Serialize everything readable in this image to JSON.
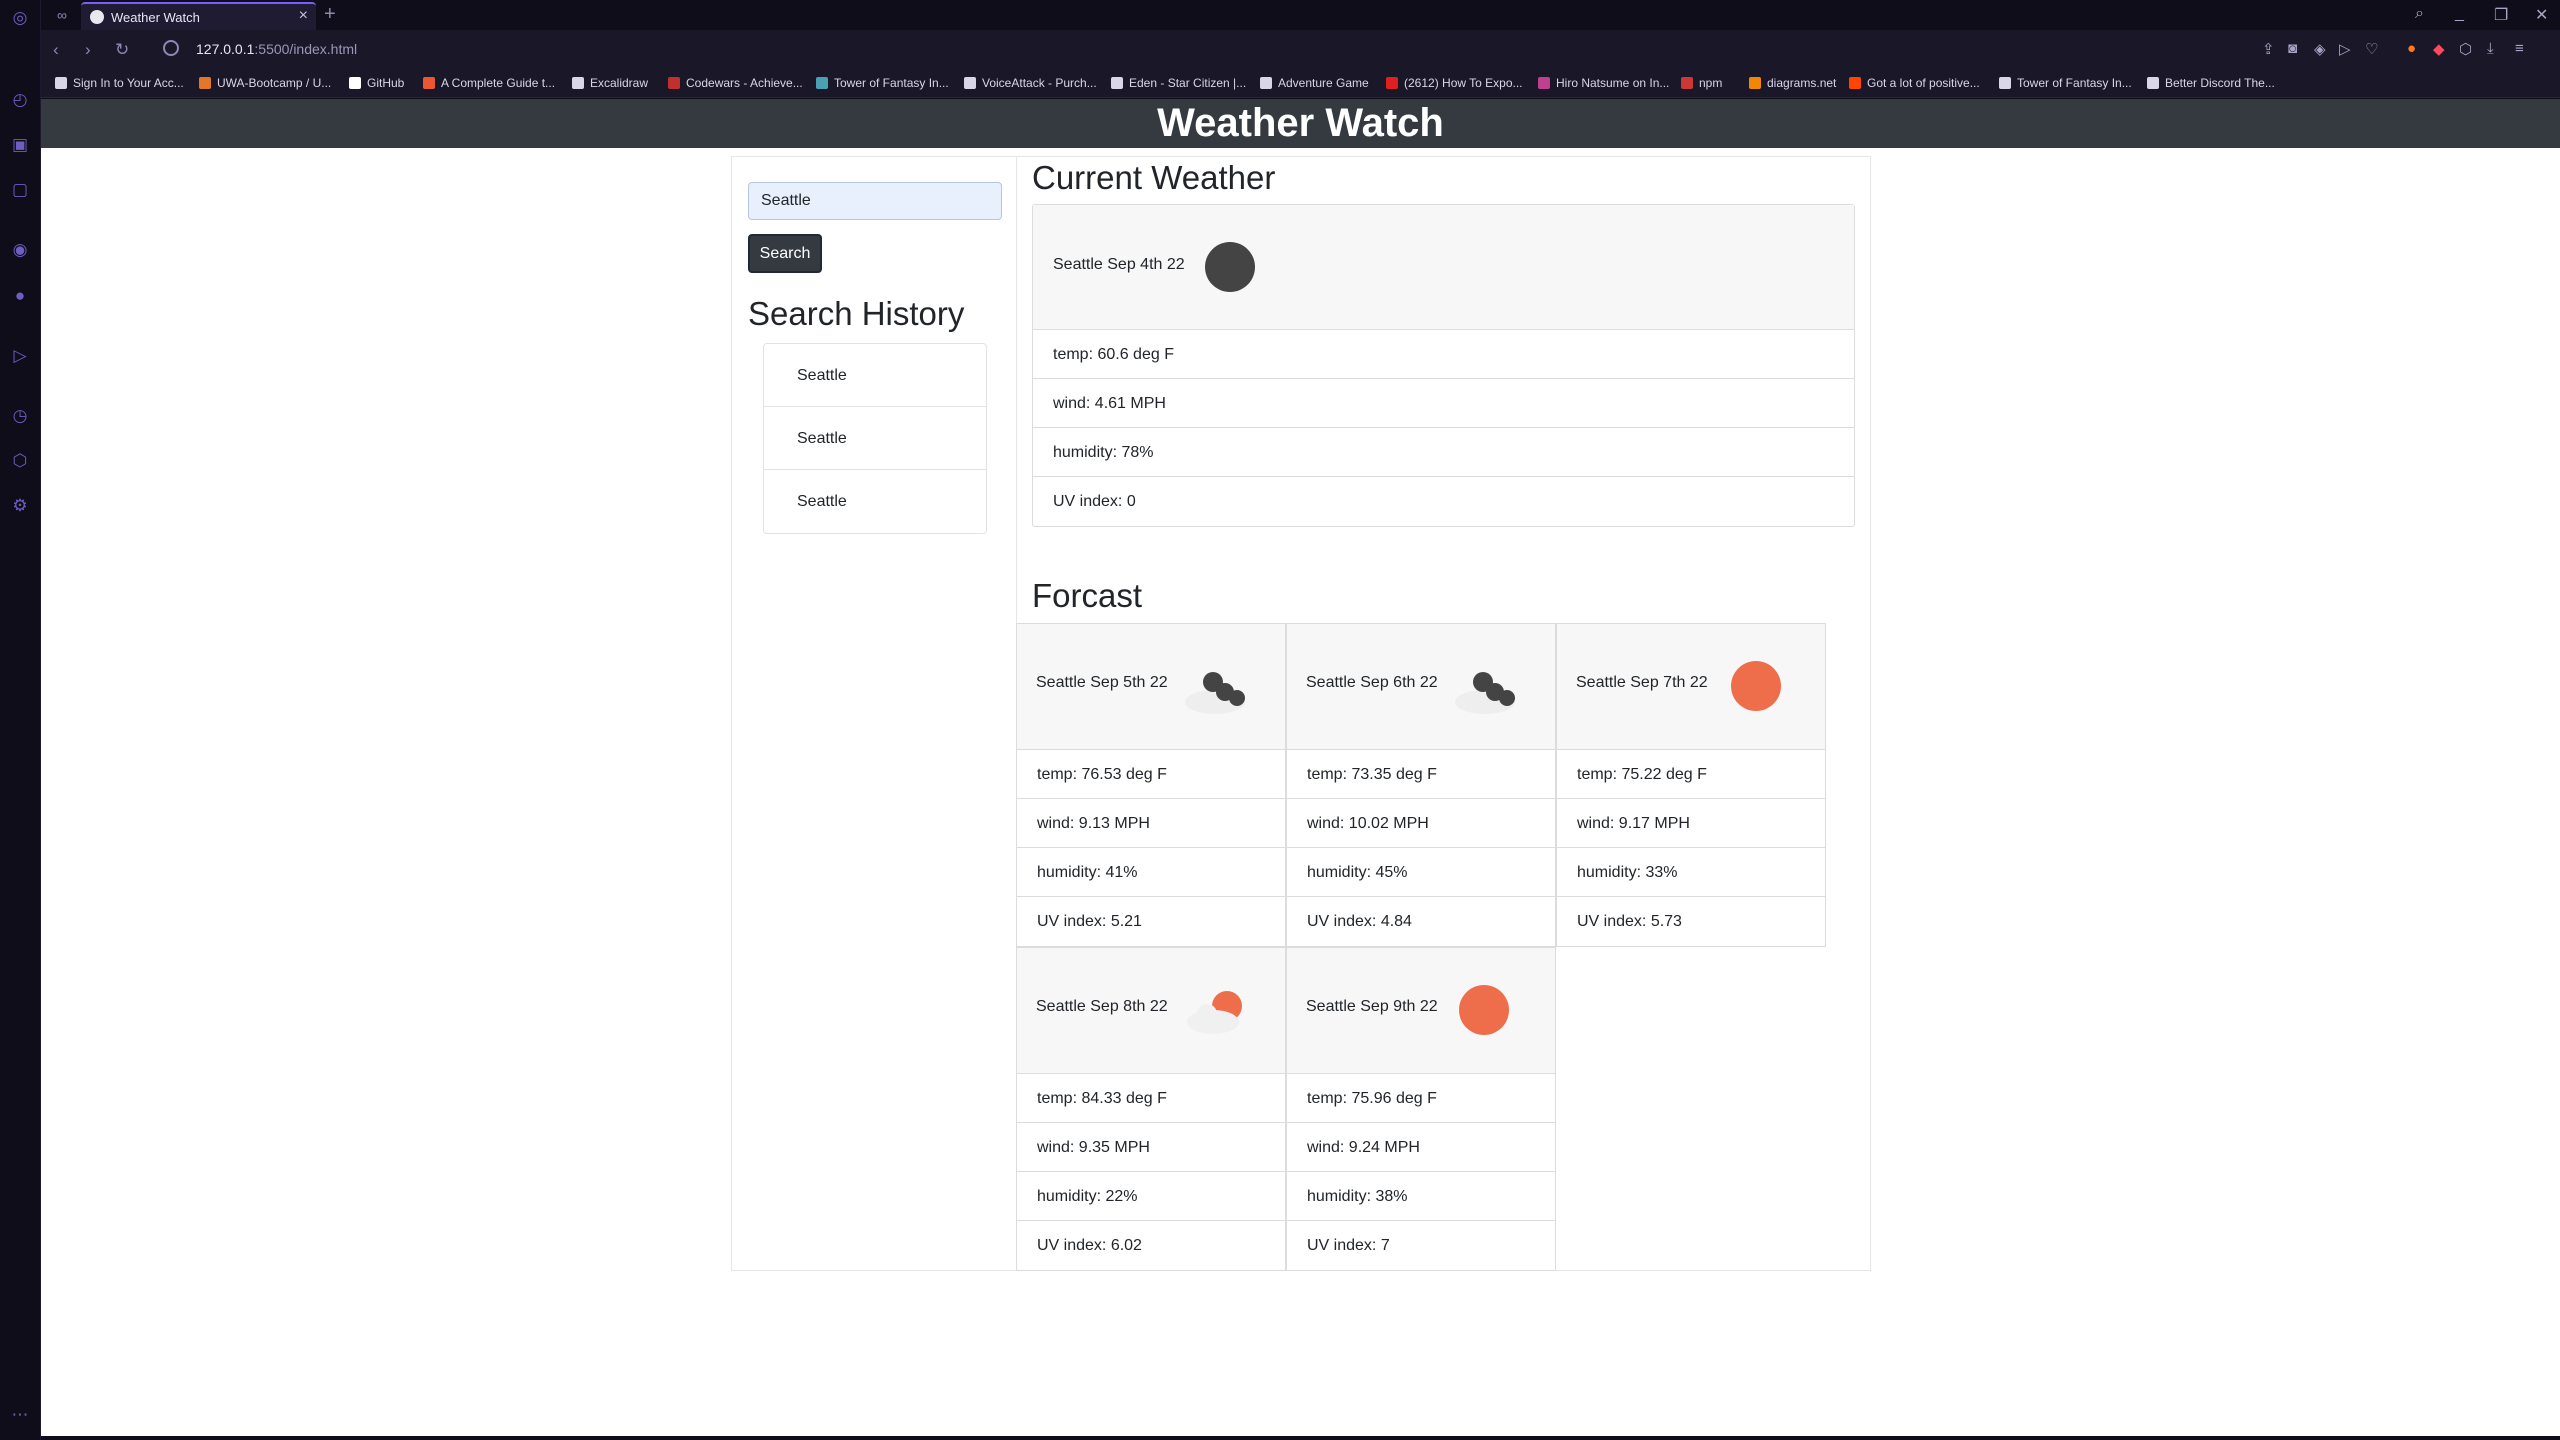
{
  "browser": {
    "tab_title": "Weather Watch",
    "url_host": "127.0.0.1",
    "url_rest": ":5500/index.html",
    "bookmarks": [
      {
        "label": "Sign In to Your Acc...",
        "color": "#d9d6ea"
      },
      {
        "label": "UWA-Bootcamp / U...",
        "color": "#e2772c"
      },
      {
        "label": "GitHub",
        "color": "#ffffff"
      },
      {
        "label": "A Complete Guide t...",
        "color": "#ee5533"
      },
      {
        "label": "Excalidraw",
        "color": "#d9d6ea"
      },
      {
        "label": "Codewars - Achieve...",
        "color": "#c22f2f"
      },
      {
        "label": "Tower of Fantasy In...",
        "color": "#4aa0b0"
      },
      {
        "label": "VoiceAttack - Purch...",
        "color": "#d9d6ea"
      },
      {
        "label": "Eden - Star Citizen |...",
        "color": "#d9d6ea"
      },
      {
        "label": "Adventure Game",
        "color": "#d9d6ea"
      },
      {
        "label": "(2612) How To Expo...",
        "color": "#e02020"
      },
      {
        "label": "Hiro Natsume on In...",
        "color": "#c04090"
      },
      {
        "label": "npm",
        "color": "#cb3837"
      },
      {
        "label": "diagrams.net",
        "color": "#f08705"
      },
      {
        "label": "Got a lot of positive...",
        "color": "#ff4500"
      },
      {
        "label": "Tower of Fantasy In...",
        "color": "#d9d6ea"
      },
      {
        "label": "Better Discord The...",
        "color": "#d9d6ea"
      }
    ]
  },
  "app": {
    "title": "Weather Watch"
  },
  "search": {
    "value": "Seattle",
    "button_label": "Search"
  },
  "history": {
    "title": "Search History",
    "items": [
      "Seattle",
      "Seattle",
      "Seattle"
    ]
  },
  "current": {
    "title": "Current Weather",
    "label": "Seattle Sep 4th 22",
    "icon": "moon-icon",
    "temp": "temp: 60.6 deg F",
    "wind": "wind: 4.61 MPH",
    "humidity": "humidity: 78%",
    "uv": "UV index: 0"
  },
  "forecast": {
    "title": "Forcast",
    "days": [
      {
        "label": "Seattle Sep 5th 22",
        "icon": "clouds-icon",
        "temp": "temp: 76.53 deg F",
        "wind": "wind: 9.13 MPH",
        "humidity": "humidity: 41%",
        "uv": "UV index: 5.21"
      },
      {
        "label": "Seattle Sep 6th 22",
        "icon": "clouds-icon",
        "temp": "temp: 73.35 deg F",
        "wind": "wind: 10.02 MPH",
        "humidity": "humidity: 45%",
        "uv": "UV index: 4.84"
      },
      {
        "label": "Seattle Sep 7th 22",
        "icon": "sun-icon",
        "temp": "temp: 75.22 deg F",
        "wind": "wind: 9.17 MPH",
        "humidity": "humidity: 33%",
        "uv": "UV index: 5.73"
      },
      {
        "label": "Seattle Sep 8th 22",
        "icon": "partly-cloudy-icon",
        "temp": "temp: 84.33 deg F",
        "wind": "wind: 9.35 MPH",
        "humidity": "humidity: 22%",
        "uv": "UV index: 6.02"
      },
      {
        "label": "Seattle Sep 9th 22",
        "icon": "sun-icon",
        "temp": "temp: 75.96 deg F",
        "wind": "wind: 9.24 MPH",
        "humidity": "humidity: 38%",
        "uv": "UV index: 7"
      }
    ]
  },
  "colors": {
    "header_bg": "#343a40",
    "sun": "#ee6e4c",
    "moon": "#444444",
    "browser_accent": "#7b5cff"
  }
}
